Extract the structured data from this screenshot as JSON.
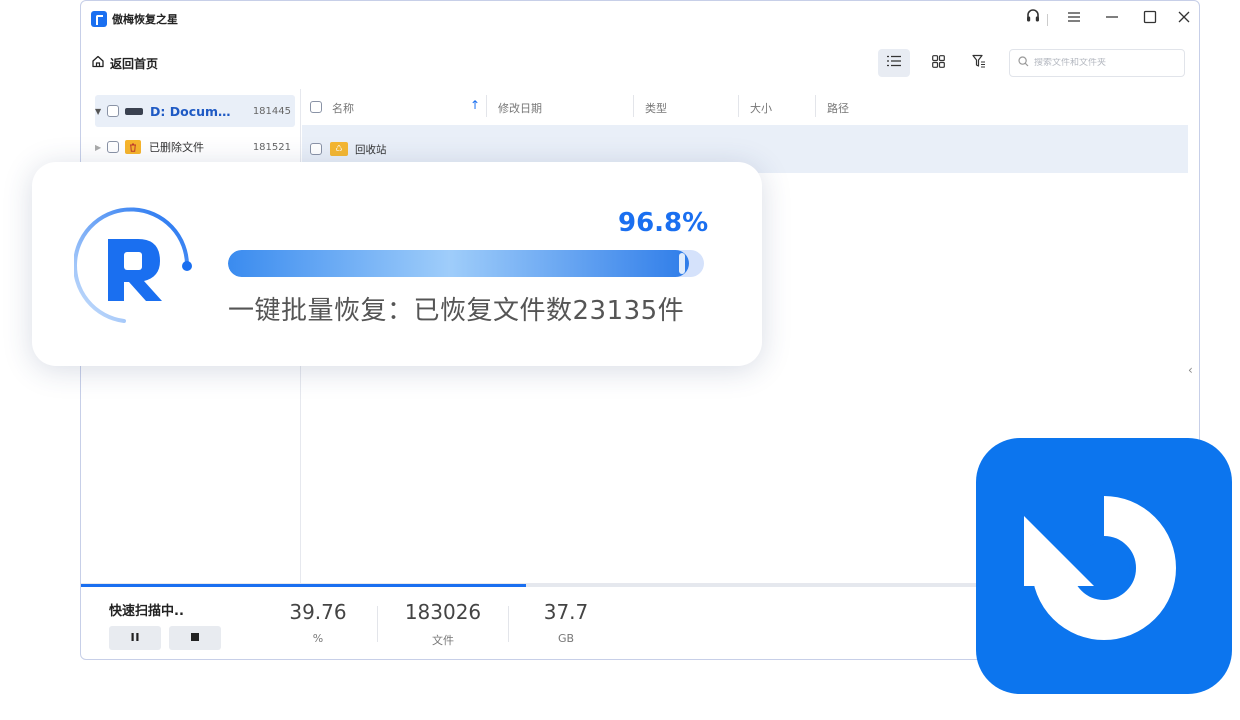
{
  "app": {
    "title": "傲梅恢复之星"
  },
  "toolbar": {
    "home_label": "返回首页",
    "search_placeholder": "搜索文件和文件夹"
  },
  "sidebar": {
    "drive": {
      "label": "D: Documents",
      "count": "181445"
    },
    "deleted": {
      "label": "已删除文件",
      "count": "181521"
    }
  },
  "list": {
    "columns": [
      "名称",
      "修改日期",
      "类型",
      "大小",
      "路径"
    ],
    "rows": [
      {
        "name": "回收站"
      }
    ]
  },
  "status": {
    "scan_label": "快速扫描中..",
    "scan_progress": 39.76,
    "stats": [
      {
        "value": "39.76",
        "unit": "%"
      },
      {
        "value": "183026",
        "unit": "文件"
      },
      {
        "value": "37.7",
        "unit": "GB"
      }
    ]
  },
  "promo": {
    "percent_text": "96.8%",
    "percent": 96.8,
    "caption": "一键批量恢复：已恢复文件数23135件"
  },
  "colors": {
    "accent": "#1a6ff0",
    "restore_bg": "#0c75ee"
  },
  "icons": [
    "app-logo-icon",
    "headset-icon",
    "menu-icon",
    "minimize-icon",
    "maximize-icon",
    "close-icon",
    "home-icon",
    "list-view-icon",
    "grid-view-icon",
    "filter-icon",
    "search-icon",
    "drive-icon",
    "trash-folder-icon",
    "recycle-folder-icon",
    "pause-icon",
    "stop-icon",
    "restore-icon"
  ]
}
